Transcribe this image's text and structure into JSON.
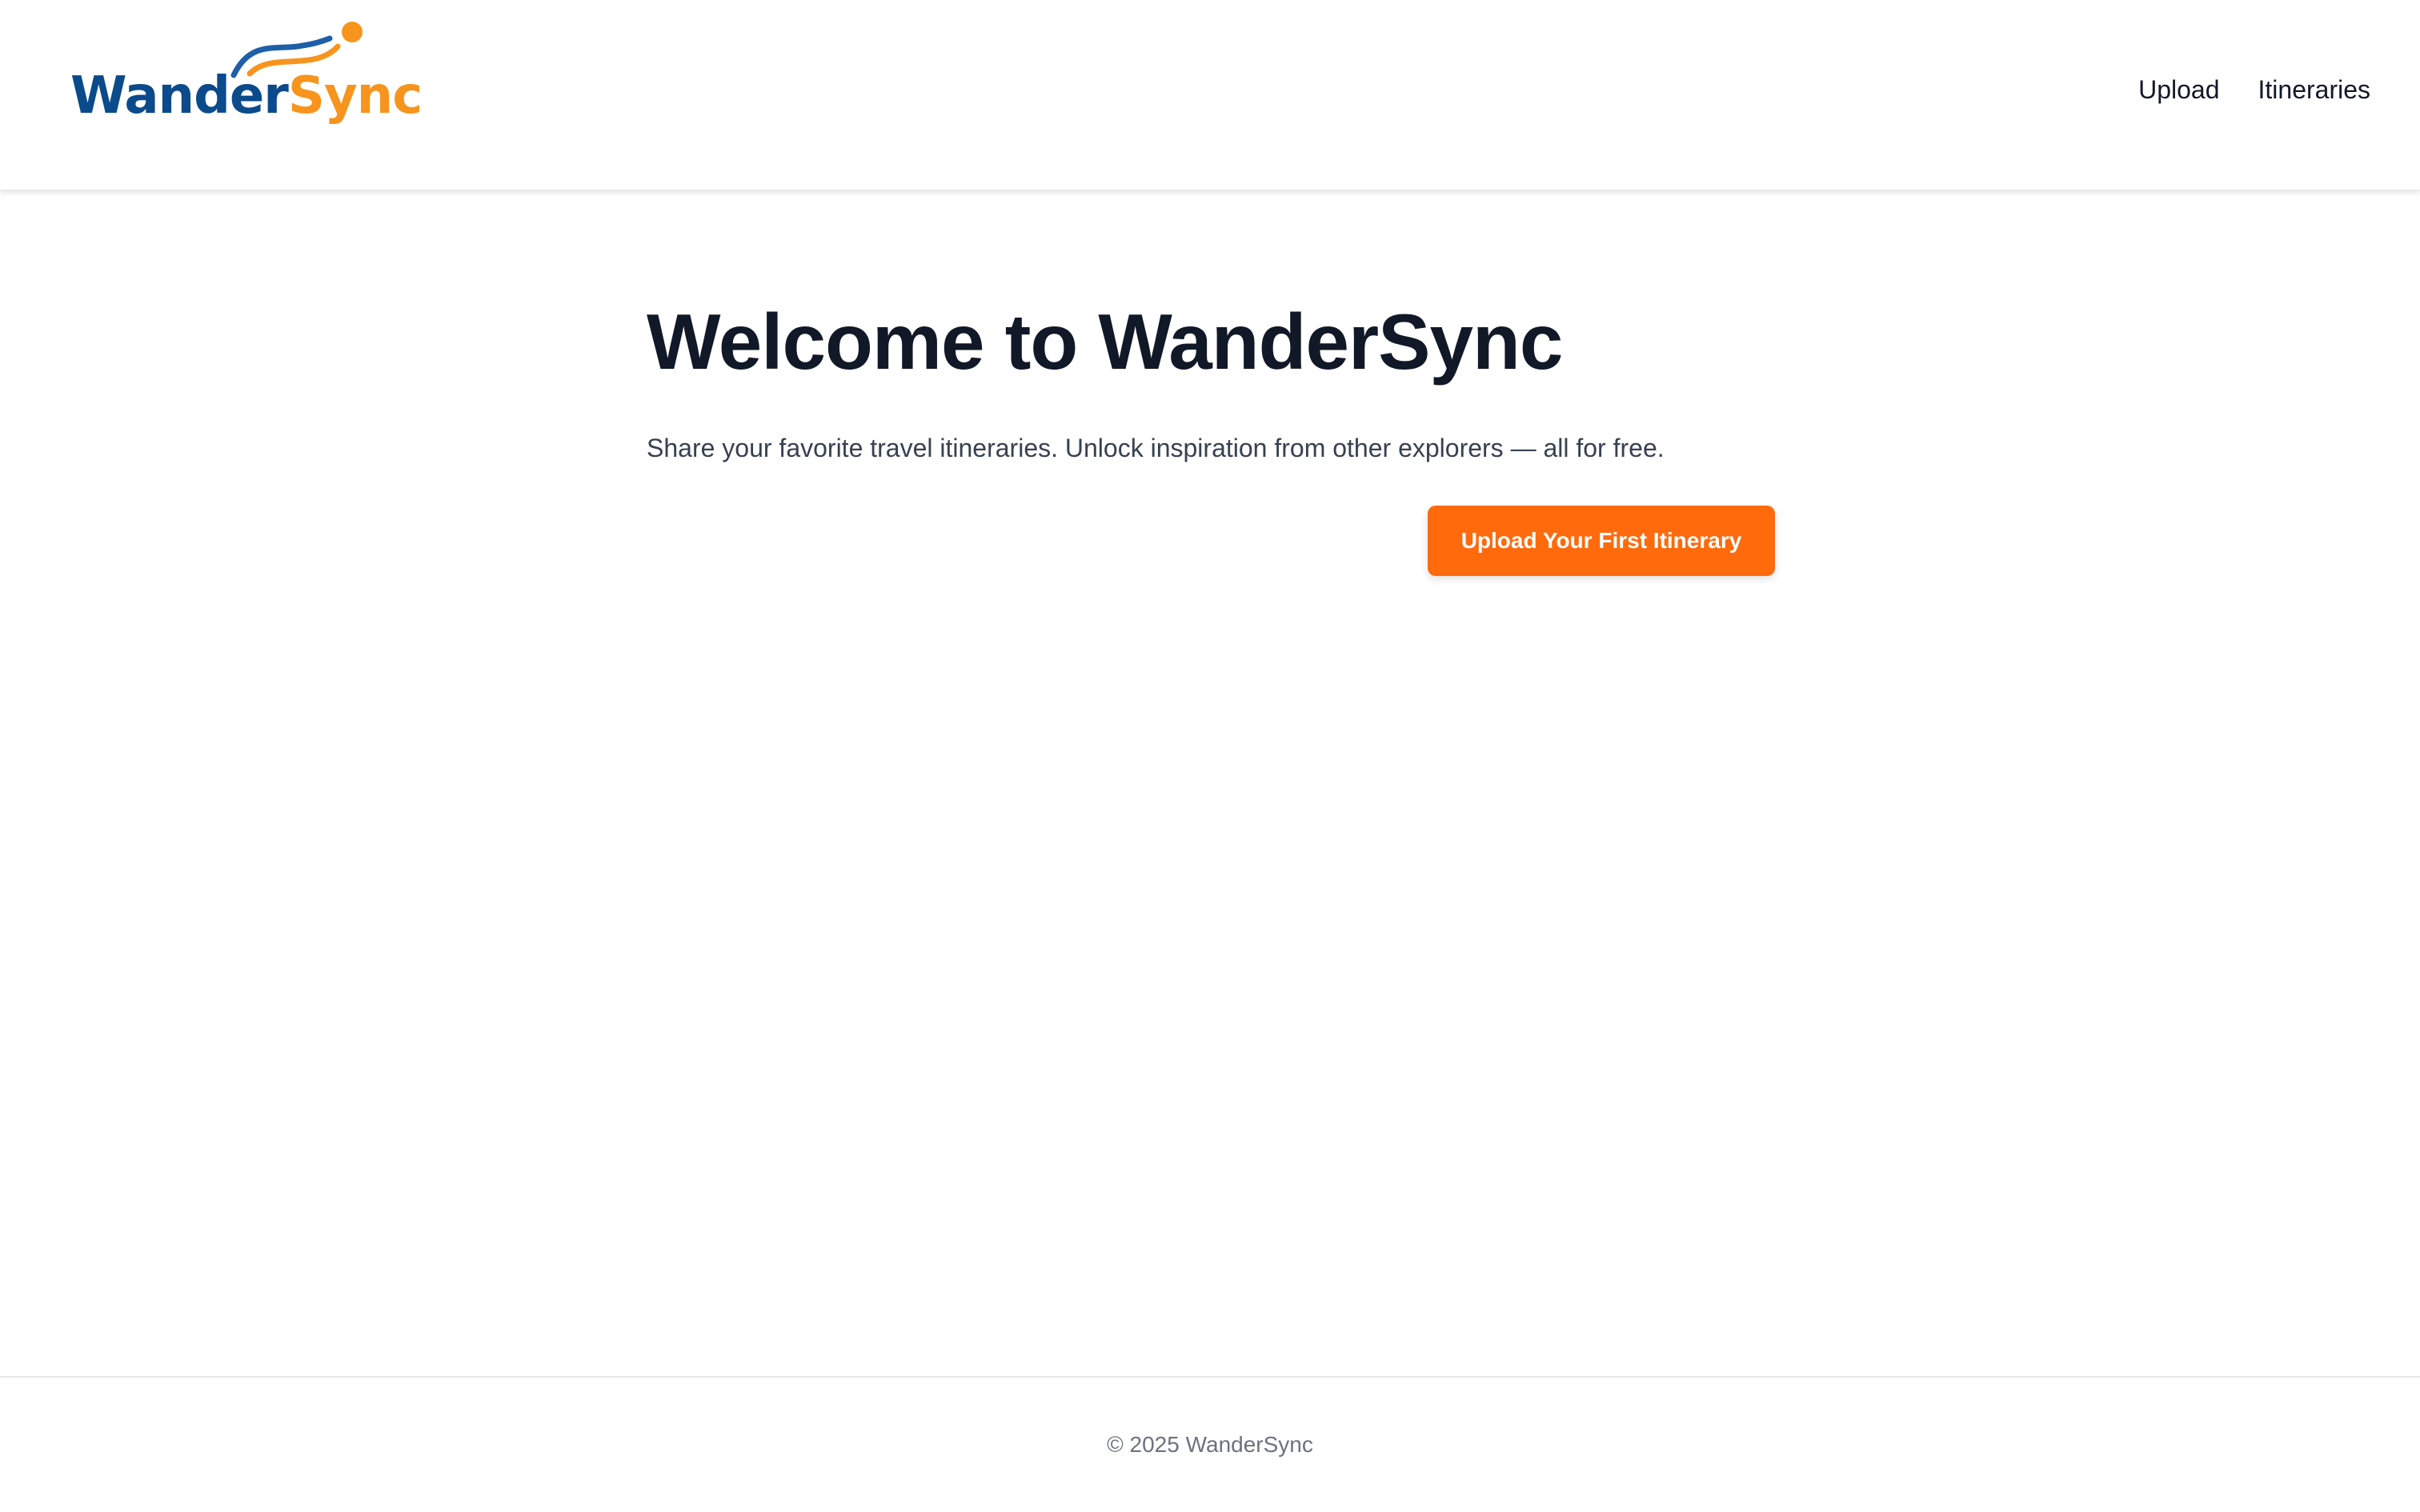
{
  "brand": {
    "name_part1": "Wander",
    "name_part2": "Sync",
    "primary_color": "#0b4a8b",
    "accent_color": "#f7941d"
  },
  "nav": {
    "items": [
      {
        "label": "Upload"
      },
      {
        "label": "Itineraries"
      }
    ]
  },
  "hero": {
    "title": "Welcome to WanderSync",
    "subtitle": "Share your favorite travel itineraries. Unlock inspiration from other explorers — all for free.",
    "cta_label": "Upload Your First Itinerary",
    "cta_color": "#ff6a0d"
  },
  "footer": {
    "copyright": "© 2025 WanderSync"
  }
}
